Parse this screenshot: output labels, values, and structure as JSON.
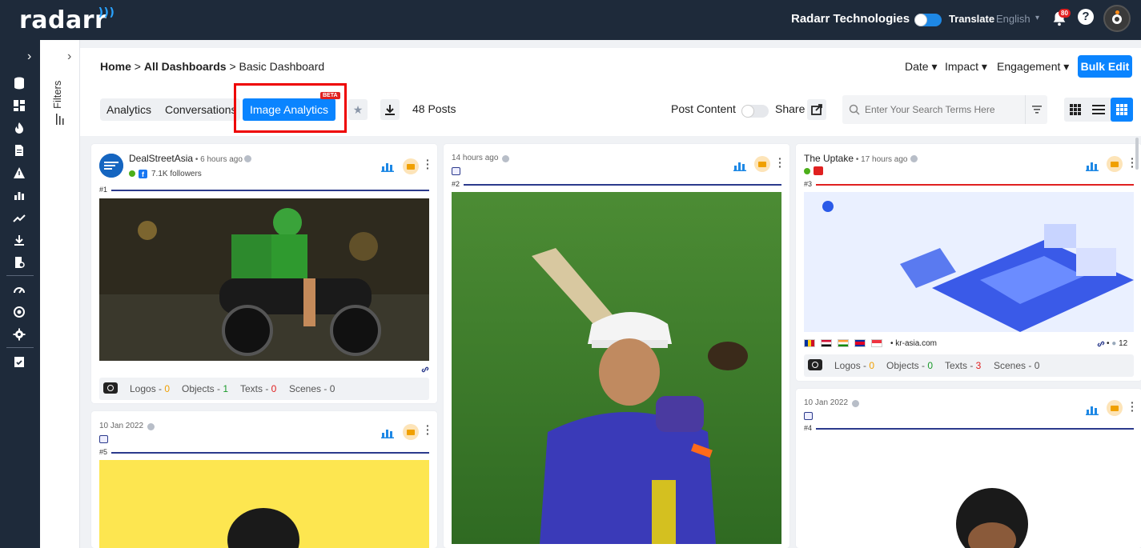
{
  "header": {
    "logo": "radarr",
    "company": "Radarr Technologies",
    "translate_label": "Translate",
    "language": "English",
    "notification_count": "80",
    "help": "?"
  },
  "breadcrumb": {
    "home": "Home",
    "dashboards": "All Dashboards",
    "current": "Basic Dashboard",
    "sep": ">"
  },
  "toolbar": {
    "date": "Date",
    "impact": "Impact",
    "engagement": "Engagement",
    "bulk_edit": "Bulk Edit",
    "post_content": "Post Content",
    "share": "Share",
    "posts_count": "48 Posts"
  },
  "tabs": {
    "analytics": "Analytics",
    "conversations": "Conversations",
    "image_analytics": "Image Analytics",
    "beta": "BETA"
  },
  "filters": {
    "label": "Filters"
  },
  "search": {
    "placeholder": "Enter Your Search Terms Here"
  },
  "cards": [
    {
      "source": "DealStreetAsia",
      "time": "6 hours ago",
      "followers": "7.1K followers",
      "rank": "#1",
      "logos_label": "Logos - ",
      "logos": "0",
      "objects_label": "Objects - ",
      "objects": "1",
      "texts_label": "Texts - ",
      "texts": "0",
      "scenes_label": "Scenes - ",
      "scenes": "0"
    },
    {
      "time": "14 hours ago",
      "rank": "#2"
    },
    {
      "source": "The Uptake",
      "time": "17 hours ago",
      "rank": "#3",
      "domain": "kr-asia.com",
      "likes": "12",
      "logos_label": "Logos - ",
      "logos": "0",
      "objects_label": "Objects - ",
      "objects": "0",
      "texts_label": "Texts - ",
      "texts": "3",
      "scenes_label": "Scenes - ",
      "scenes": "0"
    },
    {
      "time": "10 Jan 2022",
      "rank": "#4"
    },
    {
      "time": "10 Jan 2022",
      "rank": "#5"
    }
  ],
  "colors": {
    "accent": "#0a84ff",
    "header_bg": "#1e2a3a",
    "highlight_box": "#ee0000",
    "count_orange": "#f0a000",
    "count_green": "#1a9a2a",
    "count_red": "#e02020"
  }
}
